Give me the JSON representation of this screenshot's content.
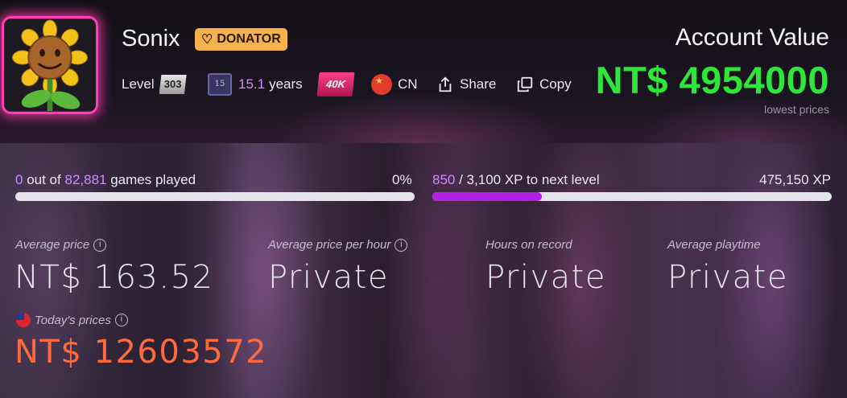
{
  "profile": {
    "name": "Sonix",
    "donator_label": "DONATOR",
    "level_label": "Level",
    "level": "303",
    "years_badge": "15",
    "years_value": "15.1",
    "years_suffix": "years",
    "badge_40k": "40K",
    "country": "CN",
    "share_label": "Share",
    "copy_label": "Copy"
  },
  "account": {
    "title": "Account Value",
    "value": "NT$ 4954000",
    "note": "lowest prices"
  },
  "games": {
    "played": "0",
    "out_of": "out of",
    "total": "82,881",
    "suffix": "games played",
    "percent_text": "0%",
    "progress": 0.0
  },
  "xp": {
    "current": "850",
    "rest": "/ 3,100 XP to next level",
    "total": "475,150 XP",
    "progress": 0.274
  },
  "stats": {
    "avg_price_label": "Average price",
    "avg_price_value": "NT$ 163.52",
    "avg_price_hour_label": "Average price per hour",
    "avg_price_hour_value": "Private",
    "hours_label": "Hours on record",
    "hours_value": "Private",
    "avg_playtime_label": "Average playtime",
    "avg_playtime_value": "Private",
    "today_label": "Today's prices",
    "today_value": "NT$ 12603572"
  },
  "colors": {
    "accent_green": "#2ee63a",
    "accent_purple": "#b321e6",
    "today_orange": "#ff6a3c",
    "donator_bg": "#f5b24a",
    "avatar_glow": "#ff3fb4"
  }
}
